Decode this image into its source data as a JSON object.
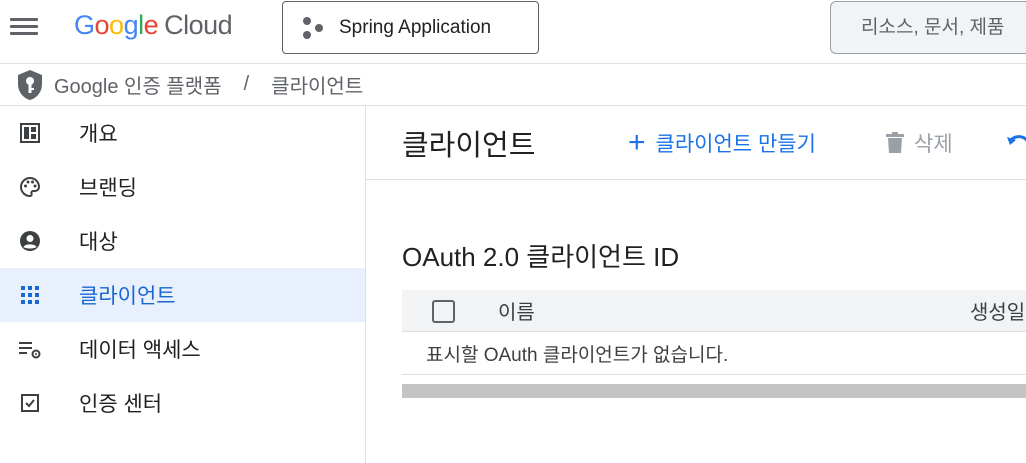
{
  "header": {
    "logo_letters": [
      "G",
      "o",
      "o",
      "g",
      "l",
      "e"
    ],
    "logo_product": "Cloud",
    "project_name": "Spring Application",
    "search_placeholder": "리소스, 문서, 제품"
  },
  "breadcrumb": {
    "product": "Google 인증 플랫폼",
    "separator": "/",
    "current": "클라이언트"
  },
  "sidebar": {
    "items": [
      {
        "label": "개요",
        "icon": "dashboard-icon",
        "active": false
      },
      {
        "label": "브랜딩",
        "icon": "palette-icon",
        "active": false
      },
      {
        "label": "대상",
        "icon": "account-circle-icon",
        "active": false
      },
      {
        "label": "클라이언트",
        "icon": "apps-grid-icon",
        "active": true
      },
      {
        "label": "데이터 액세스",
        "icon": "data-settings-icon",
        "active": false
      },
      {
        "label": "인증 센터",
        "icon": "verified-checkbox-icon",
        "active": false
      }
    ]
  },
  "main": {
    "title": "클라이언트",
    "create_label": "클라이언트 만들기",
    "delete_label": "삭제",
    "section_title": "OAuth 2.0 클라이언트 ID",
    "table": {
      "columns": [
        "이름",
        "생성일"
      ],
      "empty_message": "표시할 OAuth 클라이언트가 없습니다."
    }
  },
  "colors": {
    "accent": "#1a73e8",
    "active_bg": "#e8f0fe",
    "active_text": "#1967d2",
    "disabled": "#9aa0a6"
  }
}
